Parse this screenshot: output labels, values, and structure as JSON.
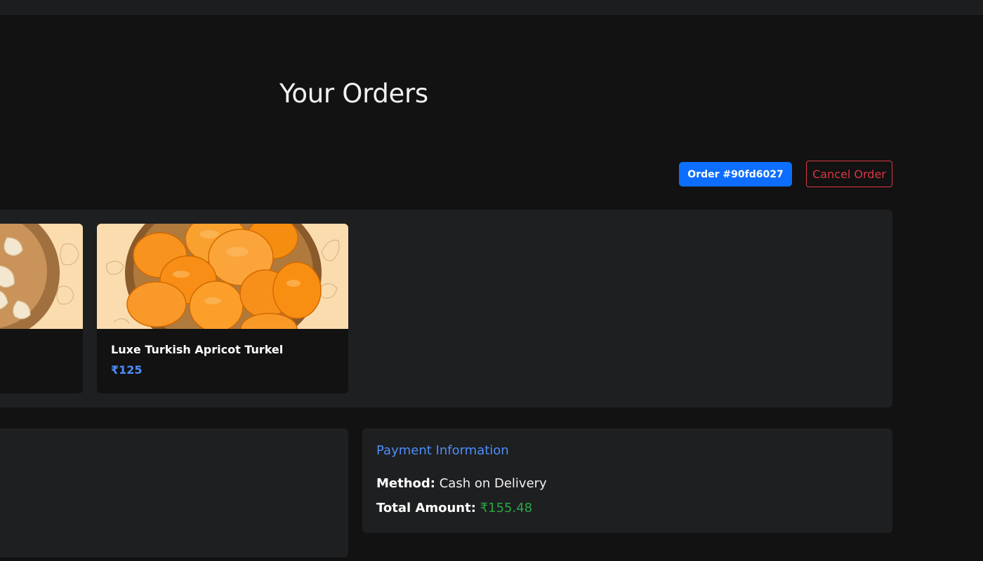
{
  "page": {
    "title": "Your Orders"
  },
  "order": {
    "badge": "Order #90fd6027",
    "cancel_label": "Cancel Order",
    "items": [
      {
        "name": "",
        "price": "",
        "image": "cashew-bowl"
      },
      {
        "name": "Luxe Turkish Apricot Turkel",
        "price": "₹125",
        "image": "dried-apricot-bowl"
      }
    ]
  },
  "payment": {
    "title": "Payment Information",
    "method_label": "Method:",
    "method_value": "Cash on Delivery",
    "total_label": "Total Amount:",
    "total_value": "₹155.48"
  },
  "colors": {
    "background": "#121212",
    "panel": "#1e1f21",
    "primary": "#0d6efd",
    "accent_blue": "#4d8ef9",
    "danger": "#dc3545",
    "success": "#28a745"
  }
}
